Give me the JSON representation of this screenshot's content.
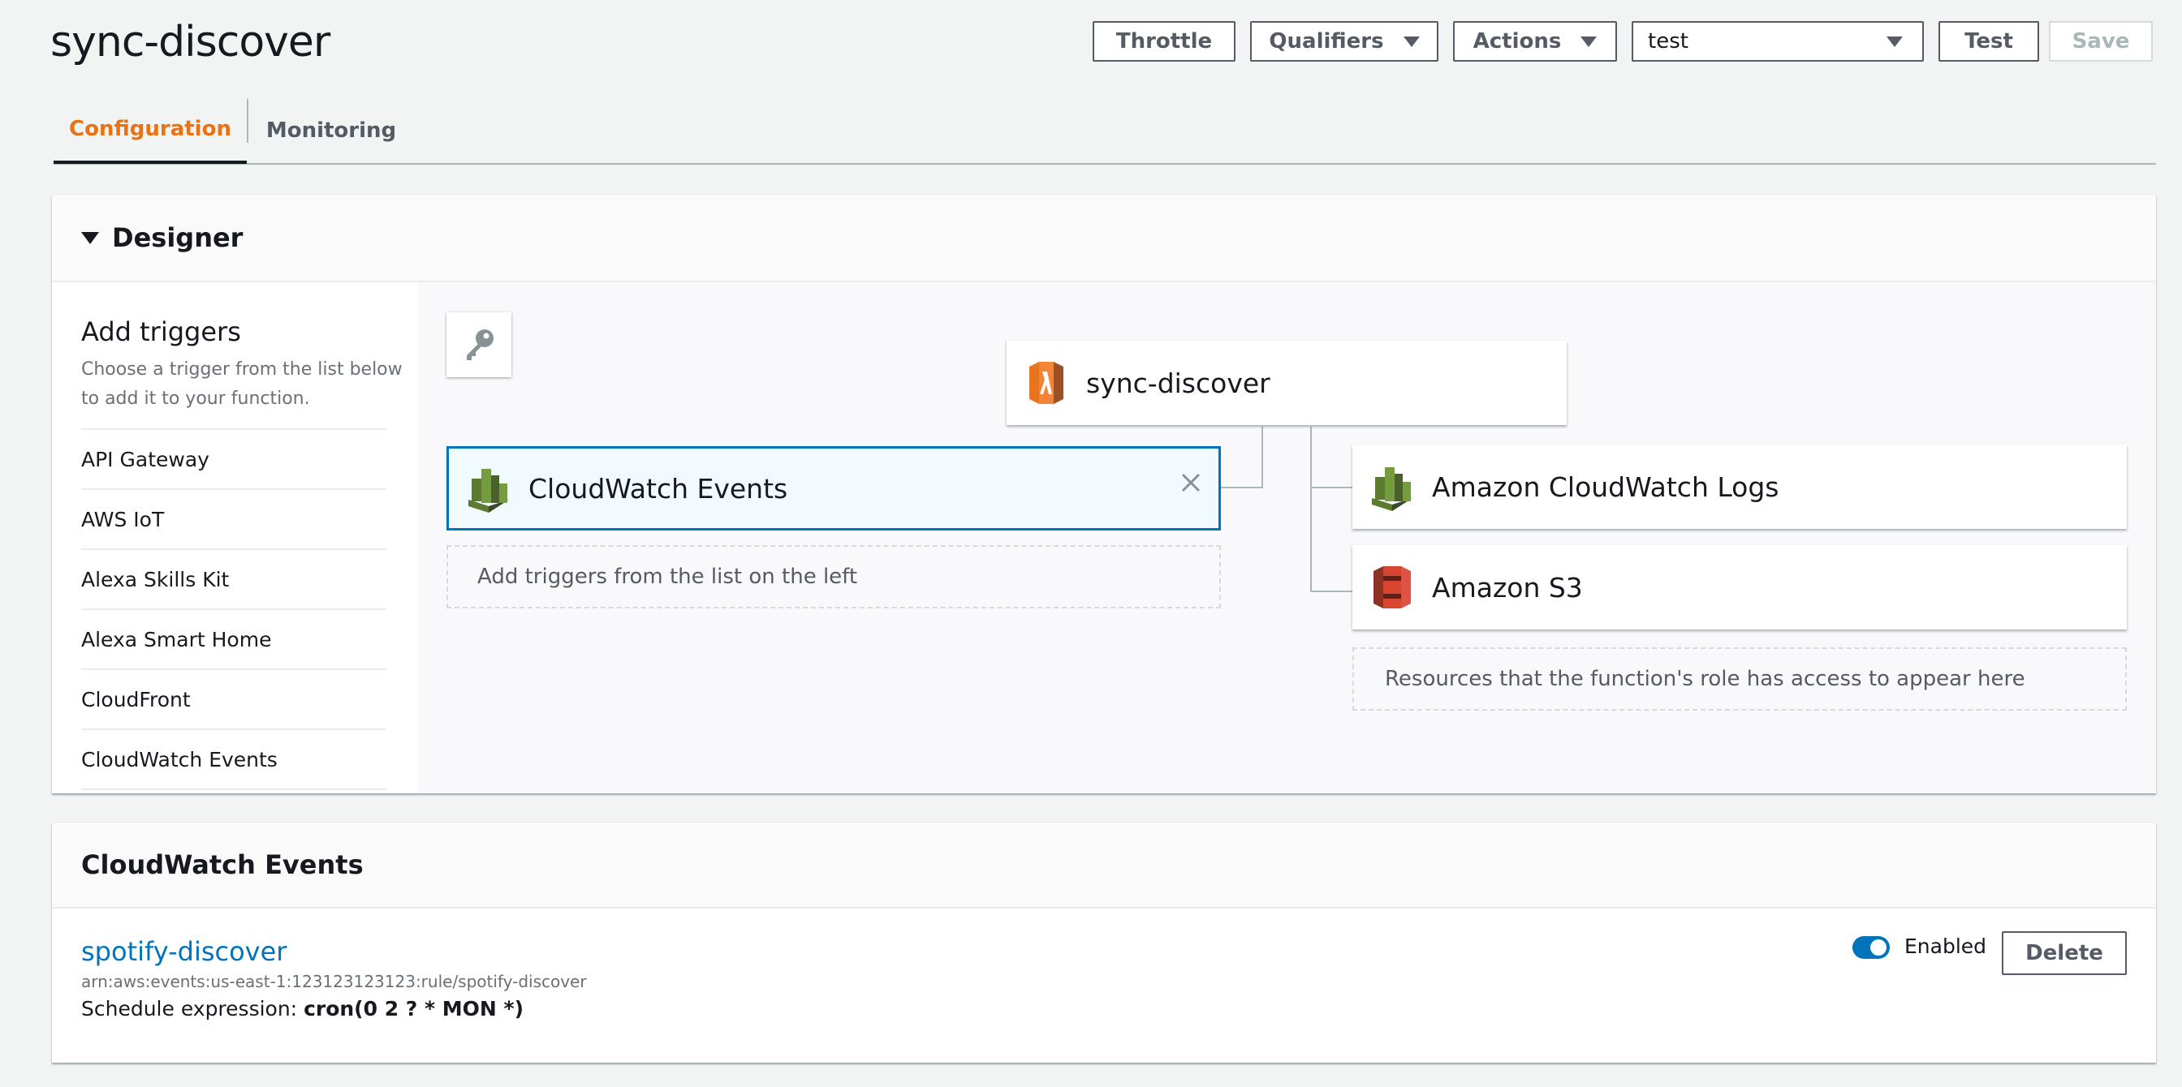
{
  "header": {
    "title": "sync-discover",
    "buttons": {
      "throttle": "Throttle",
      "qualifiers": "Qualifiers",
      "actions": "Actions",
      "test": "Test",
      "save": "Save"
    },
    "test_event_select": "test"
  },
  "tabs": {
    "configuration": "Configuration",
    "monitoring": "Monitoring",
    "active": "Configuration"
  },
  "designer": {
    "title": "Designer",
    "add_triggers": {
      "title": "Add triggers",
      "description": "Choose a trigger from the list below to add it to your function.",
      "items": [
        "API Gateway",
        "AWS IoT",
        "Alexa Skills Kit",
        "Alexa Smart Home",
        "CloudFront",
        "CloudWatch Events"
      ]
    },
    "function_name": "sync-discover",
    "trigger_card": "CloudWatch Events",
    "trigger_placeholder": "Add triggers from the list on the left",
    "resources": [
      "Amazon CloudWatch Logs",
      "Amazon S3"
    ],
    "resources_placeholder": "Resources that the function's role has access to appear here"
  },
  "trigger_details": {
    "section_title": "CloudWatch Events",
    "rule_name": "spotify-discover",
    "arn": "arn:aws:events:us-east-1:123123123123:rule/spotify-discover",
    "schedule_label": "Schedule expression:",
    "schedule_value": "cron(0 2 ? * MON *)",
    "enabled_label": "Enabled",
    "enabled": true,
    "delete_label": "Delete"
  },
  "colors": {
    "accent_orange": "#ec7211",
    "link_blue": "#0073bb",
    "lambda_orange": "#e7741e",
    "cloudwatch_green": "#759c3e",
    "s3_red": "#d9462f"
  }
}
